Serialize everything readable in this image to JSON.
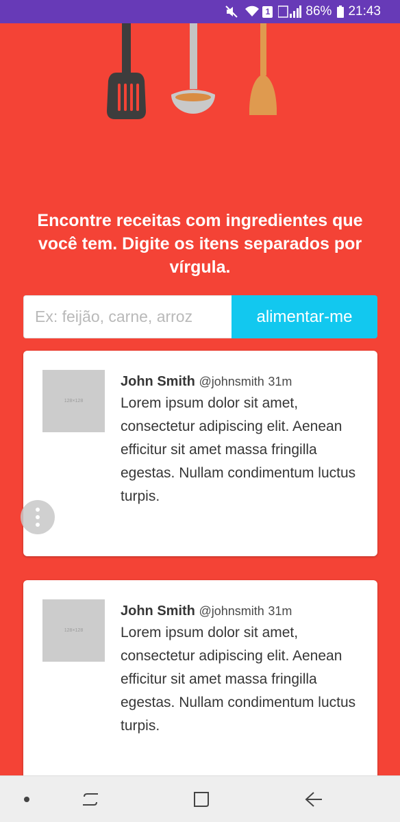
{
  "status_bar": {
    "icons": [
      "mute-icon",
      "wifi-icon",
      "sim-icon",
      "signal-icon",
      "battery-icon"
    ],
    "sim_badge": "1",
    "battery": "86%",
    "time": "21:43",
    "bg_color": "#673ab7"
  },
  "hero": {
    "utensils": [
      "spatula-icon",
      "ladle-icon",
      "wooden-spoon-icon"
    ],
    "bg_color": "#f44336"
  },
  "headline": "Encontre receitas com ingredientes que você tem. Digite os itens separados por vírgula.",
  "search": {
    "value": "",
    "placeholder": "Ex: feijão, carne, arroz",
    "button_label": "alimentar-me",
    "button_color": "#12c8ef"
  },
  "cards": [
    {
      "thumb_label": "128×128",
      "name": "John Smith",
      "handle": "@johnsmith",
      "time": "31m",
      "text": "Lorem ipsum dolor sit amet, consectetur adipiscing elit. Aenean efficitur sit amet massa fringilla egestas. Nullam condimentum luctus turpis."
    },
    {
      "thumb_label": "128×128",
      "name": "John Smith",
      "handle": "@johnsmith",
      "time": "31m",
      "text": "Lorem ipsum dolor sit amet, consectetur adipiscing elit. Aenean efficitur sit amet massa fringilla egestas. Nullam condimentum luctus turpis."
    }
  ],
  "floating_menu": {
    "icon": "more-vertical-icon"
  },
  "nav_bar": {
    "buttons": [
      "dot-indicator",
      "recent-apps-button",
      "home-button",
      "back-button"
    ]
  }
}
